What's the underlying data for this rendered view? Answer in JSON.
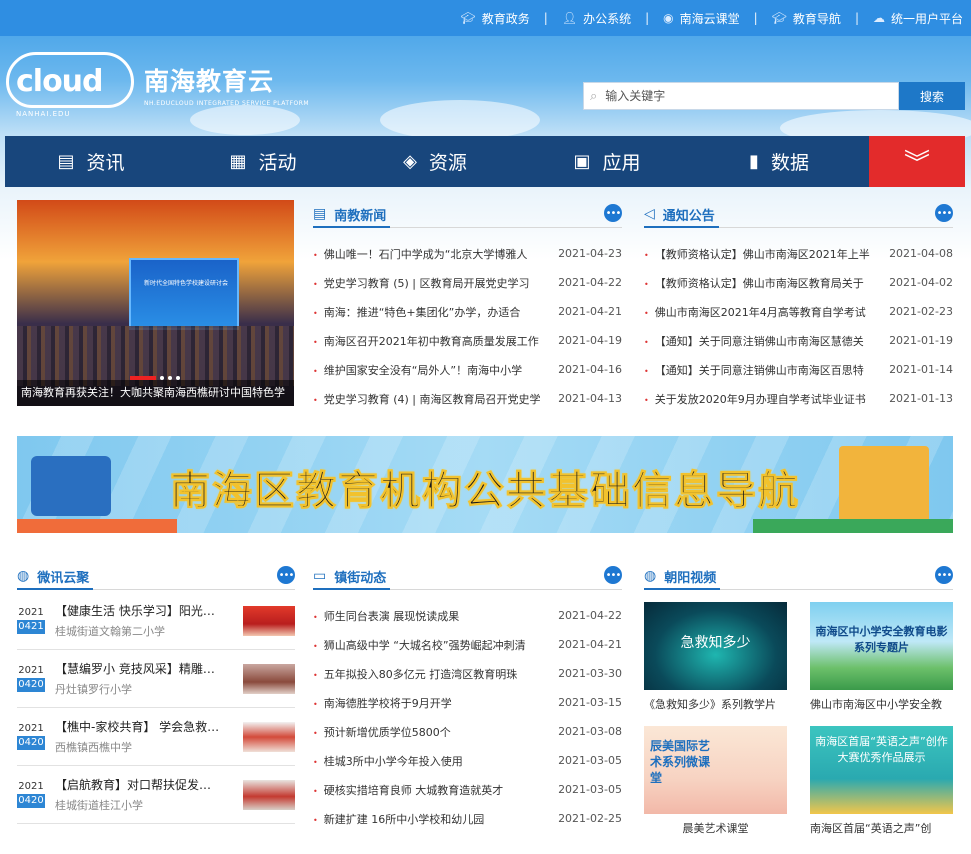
{
  "top_links": [
    {
      "label": "教育政务",
      "icon": "mortarboard-icon"
    },
    {
      "label": "办公系统",
      "icon": "user-icon"
    },
    {
      "label": "南海云课堂",
      "icon": "cloud-class-icon"
    },
    {
      "label": "教育导航",
      "icon": "mortarboard-icon"
    },
    {
      "label": "统一用户平台",
      "icon": "cloud-icon"
    }
  ],
  "logo": {
    "cloud_text": "cloud",
    "cloud_sub": "NANHAI.EDU",
    "brand": "南海教育云",
    "brand_sub": "NH.EDUCLOUD INTEGRATED SERVICE PLATFORM"
  },
  "search": {
    "placeholder": "输入关键字",
    "button": "搜索"
  },
  "nav": [
    {
      "label": "资讯",
      "icon": "news-icon"
    },
    {
      "label": "活动",
      "icon": "calendar-icon"
    },
    {
      "label": "资源",
      "icon": "layers-icon"
    },
    {
      "label": "应用",
      "icon": "apps-grid-icon"
    },
    {
      "label": "数据",
      "icon": "bar-chart-icon"
    }
  ],
  "slider": {
    "caption": "南海教育再获关注！大咖共聚南海西樵研讨中国特色学",
    "stage_text": "新时代全国特色学校建设研讨会"
  },
  "news": {
    "title": "南教新闻",
    "items": [
      {
        "title": "佛山唯一！石门中学成为“北京大学博雅人",
        "date": "2021-04-23"
      },
      {
        "title": "党史学习教育 (5) | 区教育局开展党史学习",
        "date": "2021-04-22"
      },
      {
        "title": "南海：推进“特色+集团化”办学，办适合",
        "date": "2021-04-21"
      },
      {
        "title": "南海区召开2021年初中教育高质量发展工作",
        "date": "2021-04-19"
      },
      {
        "title": "维护国家安全没有“局外人”！南海中小学",
        "date": "2021-04-16"
      },
      {
        "title": "党史学习教育 (4) | 南海区教育局召开党史学",
        "date": "2021-04-13"
      }
    ]
  },
  "notice": {
    "title": "通知公告",
    "items": [
      {
        "title": "【教师资格认定】佛山市南海区2021年上半",
        "date": "2021-04-08"
      },
      {
        "title": "【教师资格认定】佛山市南海区教育局关于",
        "date": "2021-04-02"
      },
      {
        "title": "佛山市南海区2021年4月高等教育自学考试",
        "date": "2021-02-23"
      },
      {
        "title": "【通知】关于同意注销佛山市南海区慧德关",
        "date": "2021-01-19"
      },
      {
        "title": "【通知】关于同意注销佛山市南海区百思特",
        "date": "2021-01-14"
      },
      {
        "title": "关于发放2020年9月办理自学考试毕业证书",
        "date": "2021-01-13"
      }
    ]
  },
  "banner": {
    "title": "南海区教育机构公共基础信息导航"
  },
  "weixun": {
    "title": "微讯云聚",
    "items": [
      {
        "year": "2021",
        "md": "0421",
        "title": "【健康生活 快乐学习】阳光…",
        "source": "桂城街道文翰第二小学"
      },
      {
        "year": "2021",
        "md": "0420",
        "title": "【慧编罗小 竞技风采】精雕…",
        "source": "丹灶镇罗行小学"
      },
      {
        "year": "2021",
        "md": "0420",
        "title": "【樵中-家校共育】 学会急救…",
        "source": "西樵镇西樵中学"
      },
      {
        "year": "2021",
        "md": "0420",
        "title": "【启航教育】对口帮扶促发…",
        "source": "桂城街道桂江小学"
      }
    ]
  },
  "town": {
    "title": "镇街动态",
    "items": [
      {
        "title": "师生同台表演 展现悦读成果",
        "date": "2021-04-22"
      },
      {
        "title": "狮山高级中学 “大城名校”强势崛起冲刺清",
        "date": "2021-04-21"
      },
      {
        "title": "五年拟投入80多亿元 打造湾区教育明珠",
        "date": "2021-03-30"
      },
      {
        "title": "南海德胜学校将于9月开学",
        "date": "2021-03-15"
      },
      {
        "title": "预计新增优质学位5800个",
        "date": "2021-03-08"
      },
      {
        "title": "桂城3所中小学今年投入使用",
        "date": "2021-03-05"
      },
      {
        "title": "硬核实措培育良师 大城教育造就英才",
        "date": "2021-03-05"
      },
      {
        "title": "新建扩建 16所中小学校和幼儿园",
        "date": "2021-02-25"
      }
    ]
  },
  "videos": {
    "title": "朝阳视频",
    "items": [
      {
        "caption": "《急救知多少》系列教学片",
        "overlay": "急救知多少"
      },
      {
        "caption": "佛山市南海区中小学安全教",
        "overlay": "南海区中小学安全教育电影系列专题片"
      },
      {
        "caption": "晨美艺术课堂",
        "overlay": "辰美国际艺术系列微课堂"
      },
      {
        "caption": "南海区首届“英语之声”创",
        "overlay": "南海区首届“英语之声”创作大赛优秀作品展示"
      }
    ]
  },
  "colors": {
    "nav": "#18467c",
    "accent": "#1e6fbe",
    "red": "#e32b2b",
    "topbar": "#2f8ee2"
  }
}
